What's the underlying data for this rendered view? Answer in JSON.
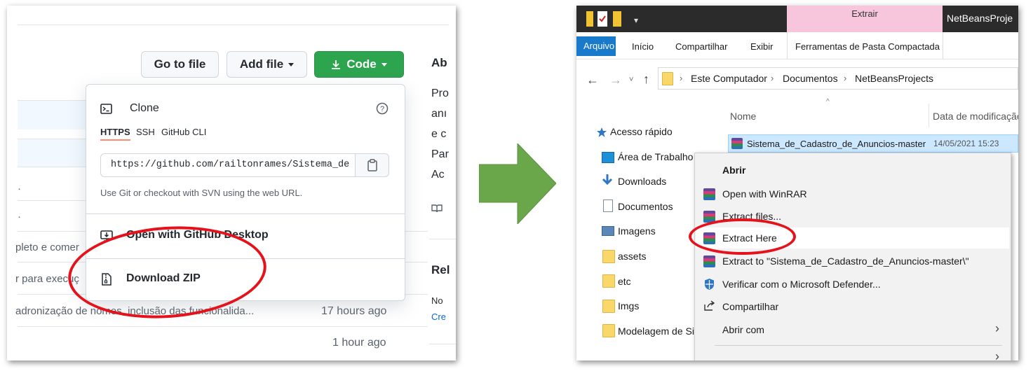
{
  "github": {
    "buttons": {
      "go_to_file": "Go to file",
      "add_file": "Add file",
      "code": "Code"
    },
    "right_col": {
      "about": "Ab",
      "frag1": "Pro",
      "frag2": "anı",
      "frag3": "e c",
      "frag4": "Par",
      "frag5": "Ac",
      "releases": "Rel",
      "no": "No",
      "create": "Cre"
    },
    "dropdown": {
      "clone_title": "Clone",
      "tabs": [
        "HTTPS",
        "SSH",
        "GitHub CLI"
      ],
      "url": "https://github.com/railtonrames/Sistema_de",
      "hint": "Use Git or checkout with SVN using the web URL.",
      "open_desktop": "Open with GitHub Desktop",
      "download_zip": "Download ZIP"
    },
    "commits": [
      {
        "message": "pleto e comer",
        "time": ""
      },
      {
        "message": "r para execuç",
        "time": ""
      },
      {
        "message": "adronização de nomes, inclusão das funcionalida...",
        "time": "17 hours ago"
      },
      {
        "message": "",
        "time": "1 hour ago"
      }
    ]
  },
  "explorer": {
    "title_tools": "Extrair",
    "title_folder": "NetBeansProje",
    "ribbon_tabs": [
      "Arquivo",
      "Início",
      "Compartilhar",
      "Exibir",
      "Ferramentas de Pasta Compactada"
    ],
    "breadcrumb": [
      "Este Computador",
      "Documentos",
      "NetBeansProjects"
    ],
    "columns": {
      "name": "Nome",
      "date": "Data de modificação"
    },
    "selected_file": {
      "name": "Sistema_de_Cadastro_de_Anuncios-master",
      "date": "14/05/2021 15:23"
    },
    "sidebar": [
      {
        "label": "Acesso rápido",
        "icon": "star-icon"
      },
      {
        "label": "Área de Trabalho",
        "icon": "desktop-icon"
      },
      {
        "label": "Downloads",
        "icon": "download-arrow-icon"
      },
      {
        "label": "Documentos",
        "icon": "document-icon"
      },
      {
        "label": "Imagens",
        "icon": "image-icon"
      },
      {
        "label": "assets",
        "icon": "folder-icon"
      },
      {
        "label": "etc",
        "icon": "folder-icon"
      },
      {
        "label": "Imgs",
        "icon": "folder-icon"
      },
      {
        "label": "Modelagem de Sist",
        "icon": "folder-icon"
      }
    ],
    "context_menu": [
      {
        "label": "Abrir",
        "icon": ""
      },
      {
        "label": "Open with WinRAR",
        "icon": "winrar-icon"
      },
      {
        "label": "Extract files...",
        "icon": "winrar-icon"
      },
      {
        "label": "Extract Here",
        "icon": "winrar-icon"
      },
      {
        "label": "Extract to \"Sistema_de_Cadastro_de_Anuncios-master\\\"",
        "icon": "winrar-icon"
      },
      {
        "label": "Verificar com o Microsoft Defender...",
        "icon": "shield-icon"
      },
      {
        "label": "Compartilhar",
        "icon": "share-icon"
      },
      {
        "label": "Abrir com",
        "icon": ""
      }
    ]
  },
  "colors": {
    "highlight": "#e5121b",
    "arrow": "#6aa64a",
    "github_green": "#2da44e",
    "tools_tab": "#f8c6dc"
  }
}
